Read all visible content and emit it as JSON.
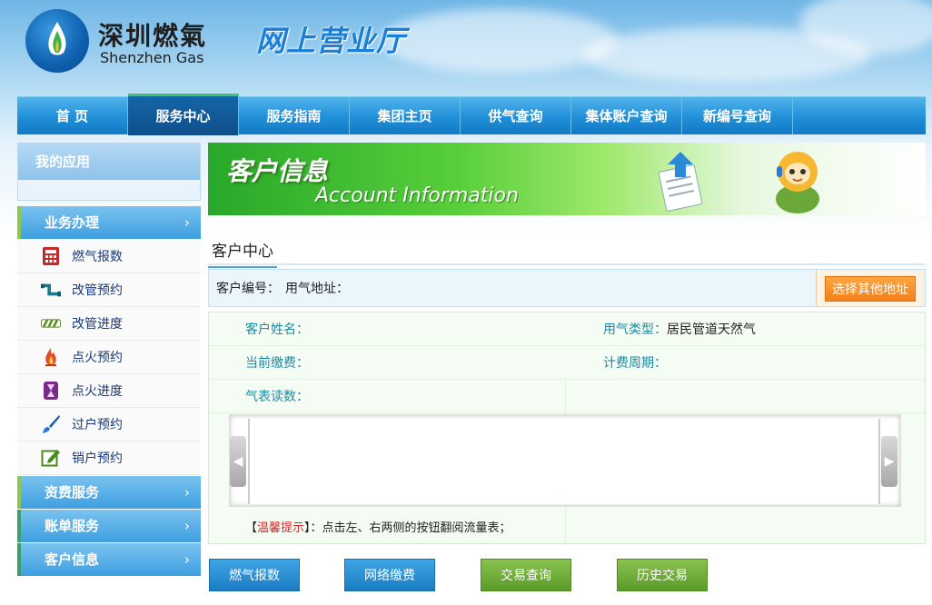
{
  "header": {
    "brand_cn": "深圳燃氣",
    "brand_en": "Shenzhen Gas",
    "slogan": "网上营业厅"
  },
  "nav": {
    "items": [
      {
        "label": "首 页"
      },
      {
        "label": "服务中心",
        "active": true
      },
      {
        "label": "服务指南"
      },
      {
        "label": "集团主页"
      },
      {
        "label": "供气查询"
      },
      {
        "label": "集体账户查询"
      },
      {
        "label": "新编号查询"
      }
    ]
  },
  "sidebar": {
    "my_apps": "我的应用",
    "groups": {
      "business": "业务办理",
      "fees": "资费服务",
      "bills": "账单服务",
      "customer": "客户信息"
    },
    "arrow": "›",
    "items": [
      {
        "label": "燃气报数",
        "icon": "calculator-icon"
      },
      {
        "label": "改管预约",
        "icon": "pipe-icon"
      },
      {
        "label": "改管进度",
        "icon": "progress-icon"
      },
      {
        "label": "点火预约",
        "icon": "flame-icon"
      },
      {
        "label": "点火进度",
        "icon": "hourglass-icon"
      },
      {
        "label": "过户预约",
        "icon": "brush-icon"
      },
      {
        "label": "销户预约",
        "icon": "edit-icon"
      }
    ]
  },
  "banner": {
    "title_cn": "客户信息",
    "title_en": "Account Information"
  },
  "main": {
    "section_title": "客户中心",
    "customer_no_label": "客户编号：",
    "address_label": "用气地址：",
    "choose_address_btn": "选择其他地址",
    "name_label": "客户姓名：",
    "gas_type_label": "用气类型：",
    "gas_type_value": "居民管道天然气",
    "current_fee_label": "当前缴费：",
    "billing_cycle_label": "计费周期：",
    "meter_reading_label": "气表读数：",
    "arrow_left": "◀",
    "arrow_right": "▶",
    "tip_open": "【",
    "tip_title": "温馨提示",
    "tip_close": "】",
    "tip_text": "：点击左、右两侧的按钮翻阅流量表；"
  },
  "actions": {
    "report": "燃气报数",
    "pay": "网络缴费",
    "transactions": "交易查询",
    "history": "历史交易"
  }
}
